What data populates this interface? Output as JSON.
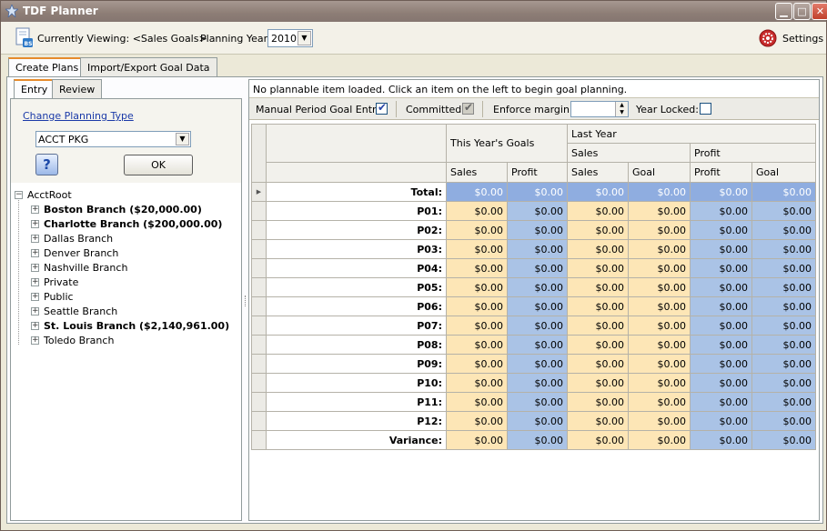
{
  "window": {
    "title": "TDF Planner",
    "colors": {
      "titlebar": "#8d7d76",
      "tan_cell": "#fde6b6",
      "blue_cell": "#aac3e6",
      "total_cell": "#8fade0",
      "active_tab": "#e68b2c"
    }
  },
  "toolbar": {
    "viewing": "Currently Viewing: <Sales Goals>",
    "year_label": "Planning Year:",
    "year_value": "2010",
    "settings_label": "Settings"
  },
  "main_tabs": [
    {
      "label": "Create Plans",
      "active": true
    },
    {
      "label": "Import/Export Goal Data",
      "active": false
    }
  ],
  "sub_tabs": [
    {
      "label": "Entry",
      "active": true
    },
    {
      "label": "Review",
      "active": false
    }
  ],
  "left": {
    "change_type_link": "Change Planning Type",
    "planning_type": "ACCT PKG",
    "help_label": "?",
    "ok_label": "OK",
    "tree": {
      "root": "AcctRoot",
      "items": [
        {
          "label": "Boston Branch ($20,000.00)",
          "bold": true
        },
        {
          "label": "Charlotte Branch ($200,000.00)",
          "bold": true
        },
        {
          "label": "Dallas Branch",
          "bold": false
        },
        {
          "label": "Denver Branch",
          "bold": false
        },
        {
          "label": "Nashville Branch",
          "bold": false
        },
        {
          "label": "Private",
          "bold": false
        },
        {
          "label": "Public",
          "bold": false
        },
        {
          "label": "Seattle Branch",
          "bold": false
        },
        {
          "label": "St. Louis Branch ($2,140,961.00)",
          "bold": true
        },
        {
          "label": "Toledo Branch",
          "bold": false
        }
      ]
    }
  },
  "right": {
    "message": "No plannable item loaded. Click an item on the left to begin goal planning.",
    "manual_entry_label": "Manual Period Goal Entry:",
    "manual_entry_checked": true,
    "committed_label": "Committed:",
    "committed_checked": true,
    "enforce_margin_label": "Enforce margin:",
    "enforce_margin_value": "",
    "year_locked_label": "Year Locked:",
    "year_locked_checked": false
  },
  "grid": {
    "header_group_1": "This Year's Goals",
    "header_group_2": "Last Year",
    "header_sub_sales": "Sales",
    "header_sub_profit": "Profit",
    "columns": [
      "Sales",
      "Profit",
      "Sales",
      "Goal",
      "Profit",
      "Goal"
    ],
    "rows": [
      {
        "label": "Total:",
        "values": [
          "$0.00",
          "$0.00",
          "$0.00",
          "$0.00",
          "$0.00",
          "$0.00"
        ]
      },
      {
        "label": "P01:",
        "values": [
          "$0.00",
          "$0.00",
          "$0.00",
          "$0.00",
          "$0.00",
          "$0.00"
        ]
      },
      {
        "label": "P02:",
        "values": [
          "$0.00",
          "$0.00",
          "$0.00",
          "$0.00",
          "$0.00",
          "$0.00"
        ]
      },
      {
        "label": "P03:",
        "values": [
          "$0.00",
          "$0.00",
          "$0.00",
          "$0.00",
          "$0.00",
          "$0.00"
        ]
      },
      {
        "label": "P04:",
        "values": [
          "$0.00",
          "$0.00",
          "$0.00",
          "$0.00",
          "$0.00",
          "$0.00"
        ]
      },
      {
        "label": "P05:",
        "values": [
          "$0.00",
          "$0.00",
          "$0.00",
          "$0.00",
          "$0.00",
          "$0.00"
        ]
      },
      {
        "label": "P06:",
        "values": [
          "$0.00",
          "$0.00",
          "$0.00",
          "$0.00",
          "$0.00",
          "$0.00"
        ]
      },
      {
        "label": "P07:",
        "values": [
          "$0.00",
          "$0.00",
          "$0.00",
          "$0.00",
          "$0.00",
          "$0.00"
        ]
      },
      {
        "label": "P08:",
        "values": [
          "$0.00",
          "$0.00",
          "$0.00",
          "$0.00",
          "$0.00",
          "$0.00"
        ]
      },
      {
        "label": "P09:",
        "values": [
          "$0.00",
          "$0.00",
          "$0.00",
          "$0.00",
          "$0.00",
          "$0.00"
        ]
      },
      {
        "label": "P10:",
        "values": [
          "$0.00",
          "$0.00",
          "$0.00",
          "$0.00",
          "$0.00",
          "$0.00"
        ]
      },
      {
        "label": "P11:",
        "values": [
          "$0.00",
          "$0.00",
          "$0.00",
          "$0.00",
          "$0.00",
          "$0.00"
        ]
      },
      {
        "label": "P12:",
        "values": [
          "$0.00",
          "$0.00",
          "$0.00",
          "$0.00",
          "$0.00",
          "$0.00"
        ]
      },
      {
        "label": "Variance:",
        "values": [
          "$0.00",
          "$0.00",
          "$0.00",
          "$0.00",
          "$0.00",
          "$0.00"
        ]
      }
    ]
  }
}
